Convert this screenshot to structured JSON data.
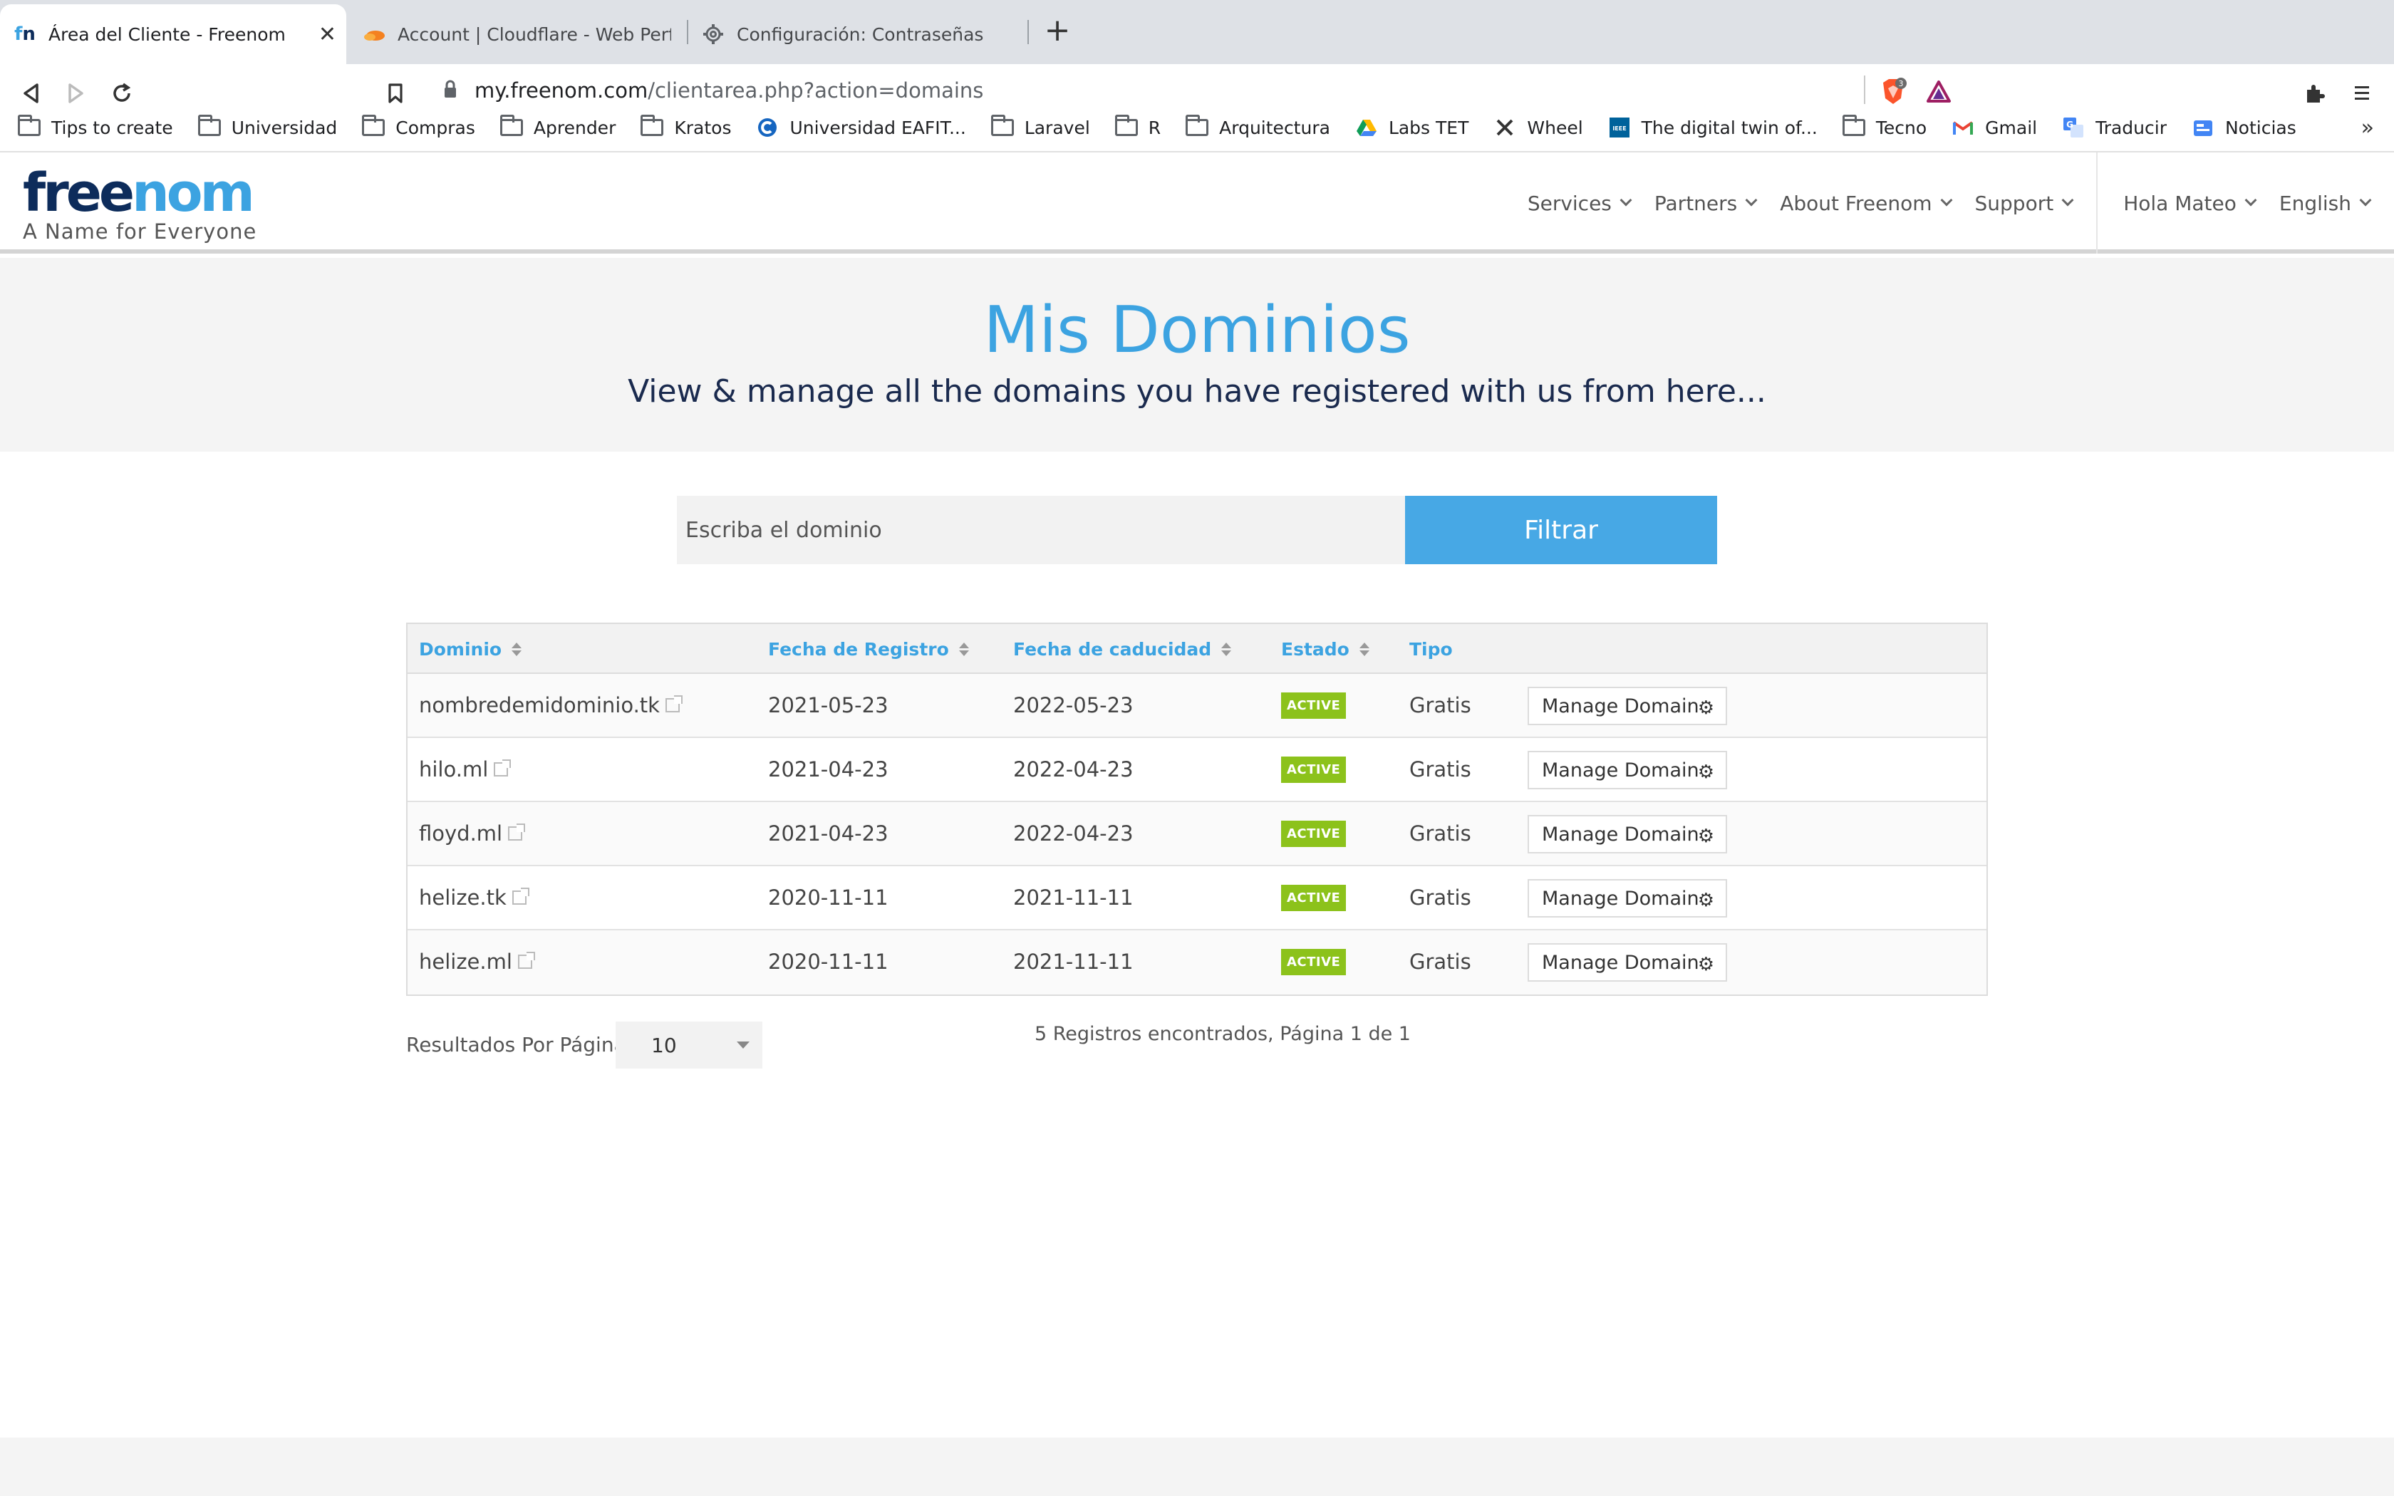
{
  "browser": {
    "tabs": [
      {
        "title": "Área del Cliente - Freenom",
        "active": true
      },
      {
        "title": "Account | Cloudflare - Web Perform",
        "active": false
      },
      {
        "title": "Configuración: Contraseñas",
        "active": false
      }
    ],
    "url_domain": "my.freenom.com",
    "url_path": "/clientarea.php?action=domains",
    "brave_badge": "3",
    "bookmarks": [
      {
        "label": "Tips to create",
        "icon": "folder-icon"
      },
      {
        "label": "Universidad",
        "icon": "folder-icon"
      },
      {
        "label": "Compras",
        "icon": "folder-icon"
      },
      {
        "label": "Aprender",
        "icon": "folder-icon"
      },
      {
        "label": "Kratos",
        "icon": "folder-icon"
      },
      {
        "label": "Universidad EAFIT...",
        "icon": "site-icon"
      },
      {
        "label": "Laravel",
        "icon": "folder-icon"
      },
      {
        "label": "R",
        "icon": "folder-icon"
      },
      {
        "label": "Arquitectura",
        "icon": "folder-icon"
      },
      {
        "label": "Labs TET",
        "icon": "drive-icon"
      },
      {
        "label": "Wheel",
        "icon": "tools-icon"
      },
      {
        "label": "The digital twin of...",
        "icon": "ieee-icon"
      },
      {
        "label": "Tecno",
        "icon": "folder-icon"
      },
      {
        "label": "Gmail",
        "icon": "gmail-icon"
      },
      {
        "label": "Traducir",
        "icon": "translate-icon"
      },
      {
        "label": "Noticias",
        "icon": "news-icon"
      }
    ]
  },
  "site": {
    "logo_part1": "free",
    "logo_part2": "nom",
    "tagline": "A Name for Everyone",
    "nav": [
      "Services",
      "Partners",
      "About Freenom",
      "Support"
    ],
    "user_menu": "Hola Mateo",
    "language": "English",
    "colors": {
      "brand_blue": "#3ca3e1",
      "brand_dark": "#0d2c5b",
      "active_green": "#8cc21b"
    }
  },
  "hero": {
    "title": "Mis Dominios",
    "subtitle": "View & manage all the domains you have registered with us from here..."
  },
  "filter": {
    "placeholder": "Escriba el dominio",
    "button": "Filtrar"
  },
  "table": {
    "headers": {
      "domain": "Dominio",
      "registered": "Fecha de Registro",
      "expires": "Fecha de caducidad",
      "status": "Estado",
      "type": "Tipo"
    },
    "rows": [
      {
        "domain": "nombredemidominio.tk",
        "registered": "2021-05-23",
        "expires": "2022-05-23",
        "status": "ACTIVE",
        "type": "Gratis",
        "action": "Manage Domain"
      },
      {
        "domain": "hilo.ml",
        "registered": "2021-04-23",
        "expires": "2022-04-23",
        "status": "ACTIVE",
        "type": "Gratis",
        "action": "Manage Domain"
      },
      {
        "domain": "floyd.ml",
        "registered": "2021-04-23",
        "expires": "2022-04-23",
        "status": "ACTIVE",
        "type": "Gratis",
        "action": "Manage Domain"
      },
      {
        "domain": "helize.tk",
        "registered": "2020-11-11",
        "expires": "2021-11-11",
        "status": "ACTIVE",
        "type": "Gratis",
        "action": "Manage Domain"
      },
      {
        "domain": "helize.ml",
        "registered": "2020-11-11",
        "expires": "2021-11-11",
        "status": "ACTIVE",
        "type": "Gratis",
        "action": "Manage Domain"
      }
    ]
  },
  "pagination": {
    "per_page_label": "Resultados Por Página:",
    "per_page_value": "10",
    "records_text": "5 Registros encontrados, Página 1 de 1"
  }
}
